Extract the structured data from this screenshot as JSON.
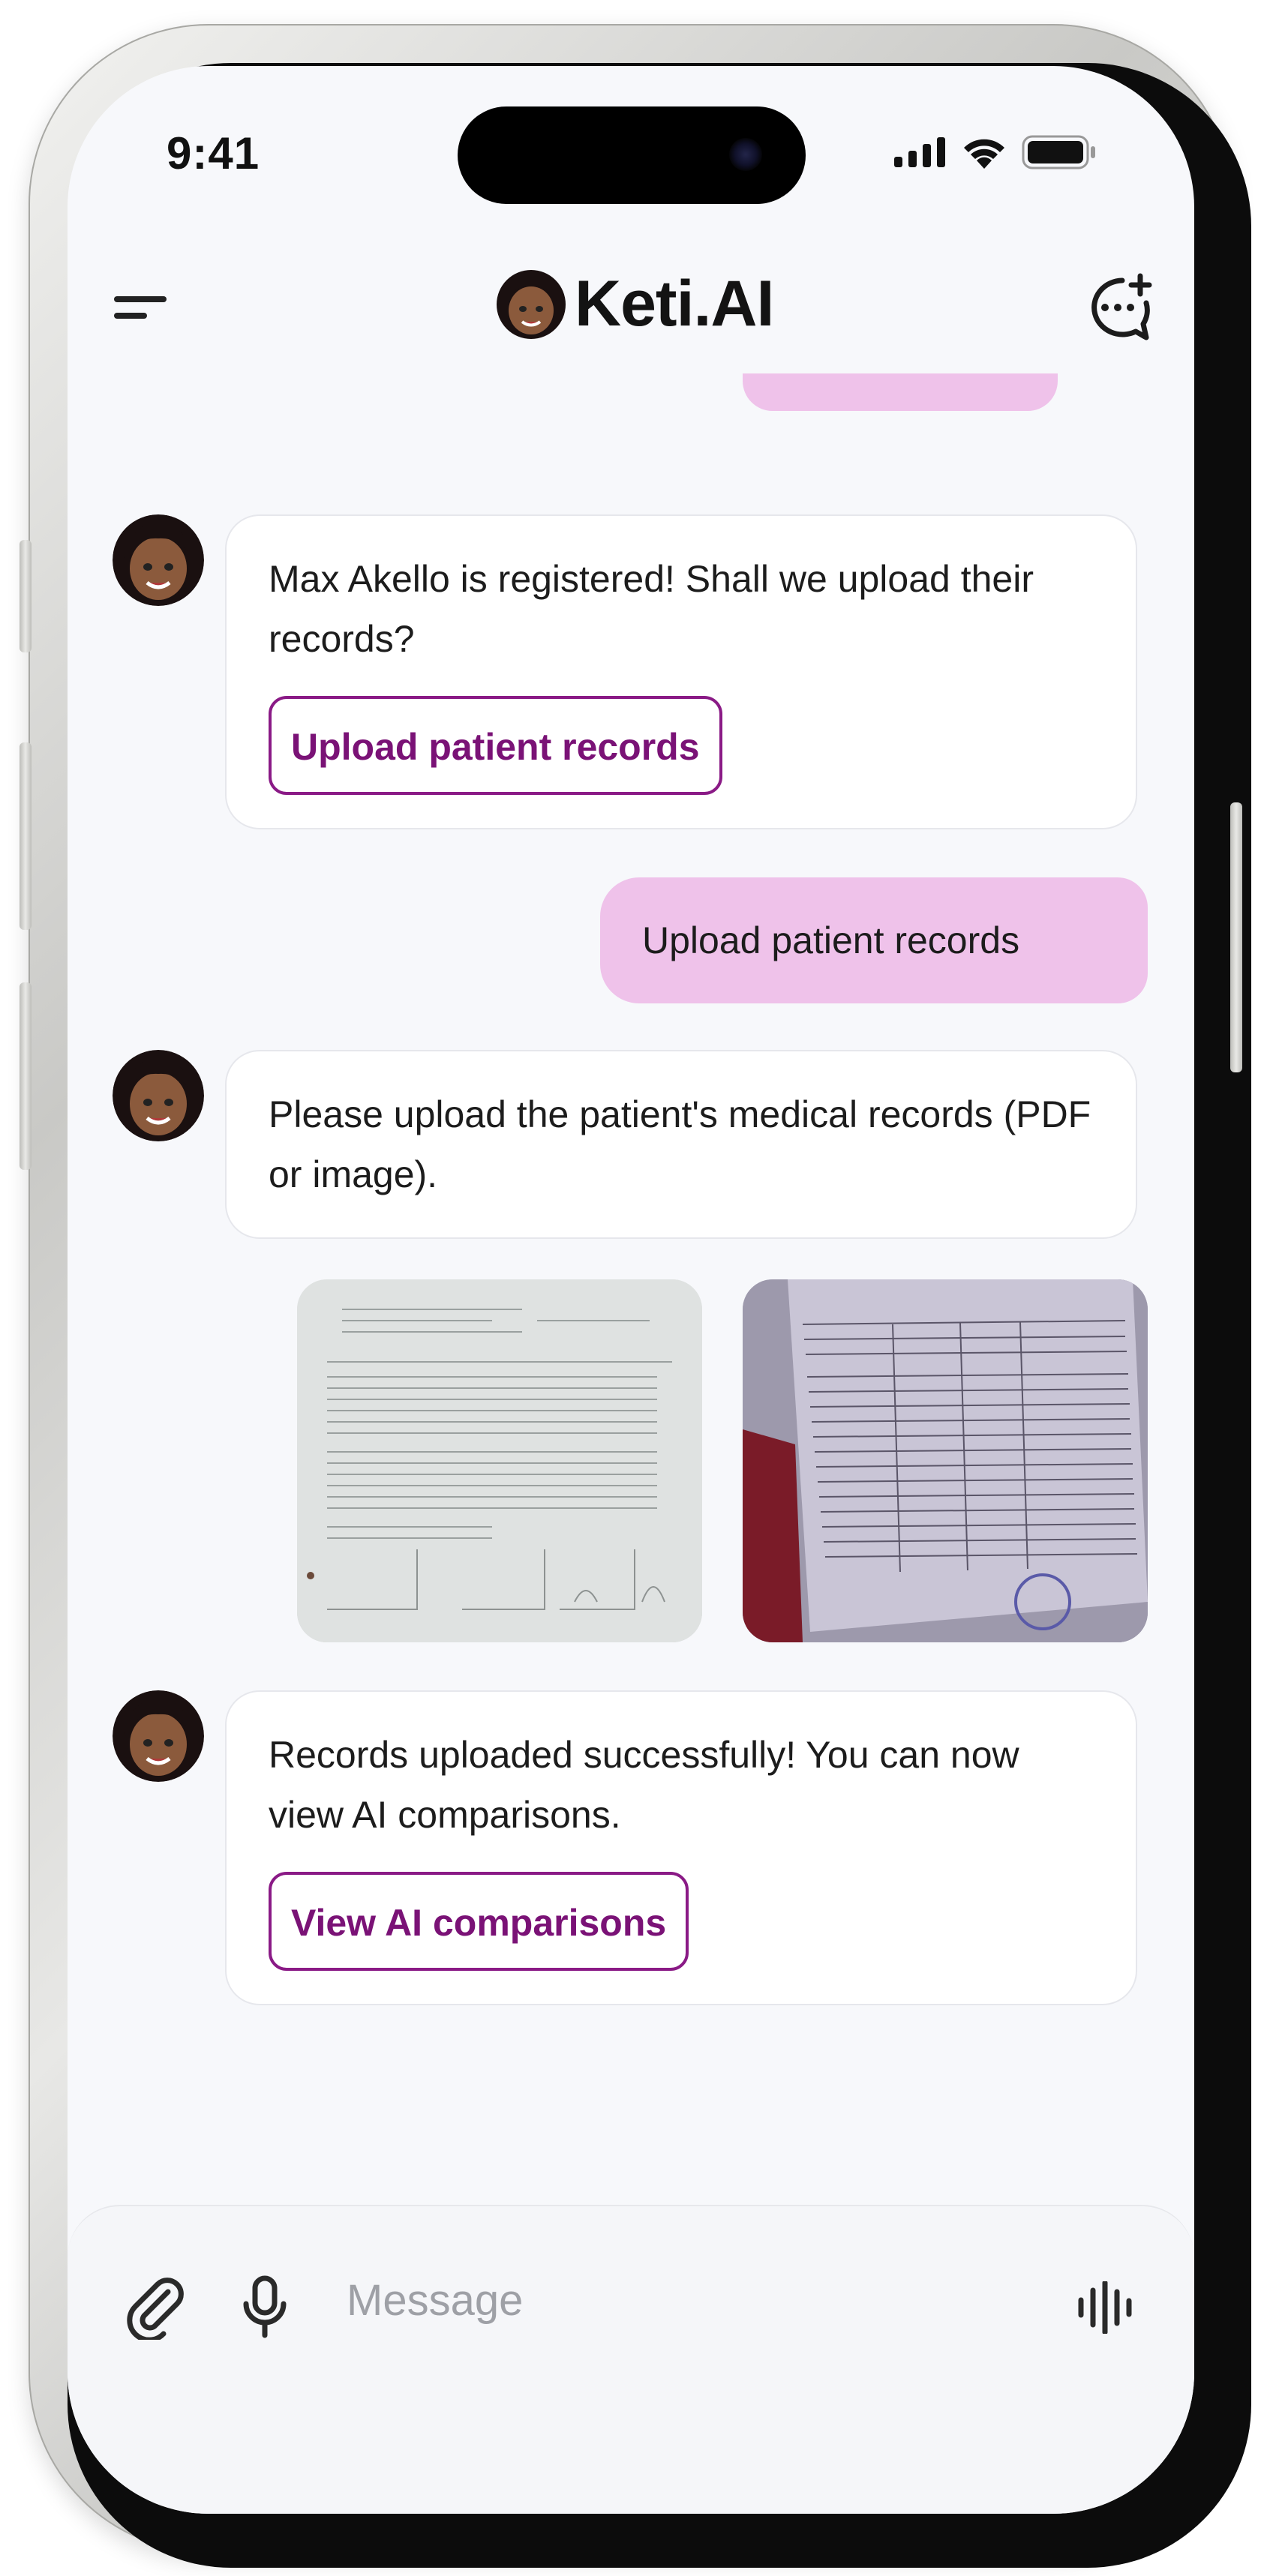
{
  "status_bar": {
    "time": "9:41"
  },
  "header": {
    "title": "Keti.AI"
  },
  "messages": [
    {
      "sender": "bot",
      "text": "Max Akello is registered! Shall we upload their records?",
      "button": "Upload patient records"
    },
    {
      "sender": "user",
      "text": "Upload patient records"
    },
    {
      "sender": "bot",
      "text": "Please upload the patient's medical records (PDF or image)."
    },
    {
      "sender": "bot",
      "text": "Records uploaded successfully! You can now view AI comparisons.",
      "button": "View AI comparisons"
    }
  ],
  "composer": {
    "placeholder": "Message"
  },
  "colors": {
    "accent": "#7a1276",
    "user_bubble": "#efc2ea",
    "background": "#f7f8fb"
  },
  "icons": [
    "menu-icon",
    "new-chat-icon",
    "paperclip-icon",
    "microphone-icon",
    "voice-waveform-icon"
  ]
}
